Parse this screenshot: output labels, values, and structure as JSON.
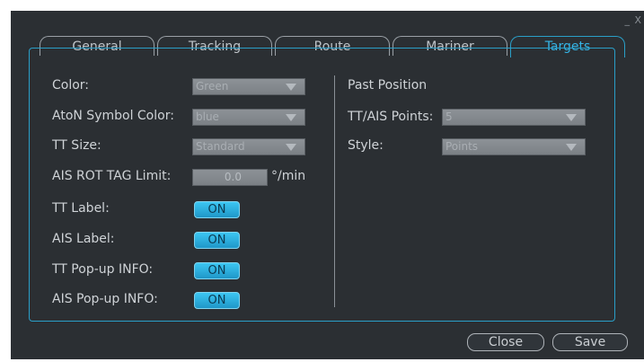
{
  "window": {
    "controls": "_ X"
  },
  "tabs": [
    {
      "label": "General"
    },
    {
      "label": "Tracking"
    },
    {
      "label": "Route"
    },
    {
      "label": "Mariner"
    },
    {
      "label": "Targets"
    }
  ],
  "left": {
    "color": {
      "label": "Color:",
      "value": "Green"
    },
    "aton_symbol_color": {
      "label": "AtoN Symbol Color:",
      "value": "blue"
    },
    "tt_size": {
      "label": "TT Size:",
      "value": "Standard"
    },
    "ais_rot_tag_limit": {
      "label": "AIS ROT TAG Limit:",
      "value": "0.0",
      "unit": "°/min"
    },
    "tt_label": {
      "label": "TT Label:",
      "value": "ON"
    },
    "ais_label": {
      "label": "AIS Label:",
      "value": "ON"
    },
    "tt_popup_info": {
      "label": "TT Pop-up INFO:",
      "value": "ON"
    },
    "ais_popup_info": {
      "label": "AIS Pop-up INFO:",
      "value": "ON"
    }
  },
  "right": {
    "section_title": "Past Position",
    "tt_ais_points": {
      "label": "TT/AIS Points:",
      "value": "5"
    },
    "style": {
      "label": "Style:",
      "value": "Points"
    }
  },
  "buttons": {
    "close": "Close",
    "save": "Save"
  },
  "colors": {
    "accent": "#2a9fc8",
    "toggle_on": "#35b4e6",
    "background": "#2b2f33"
  }
}
